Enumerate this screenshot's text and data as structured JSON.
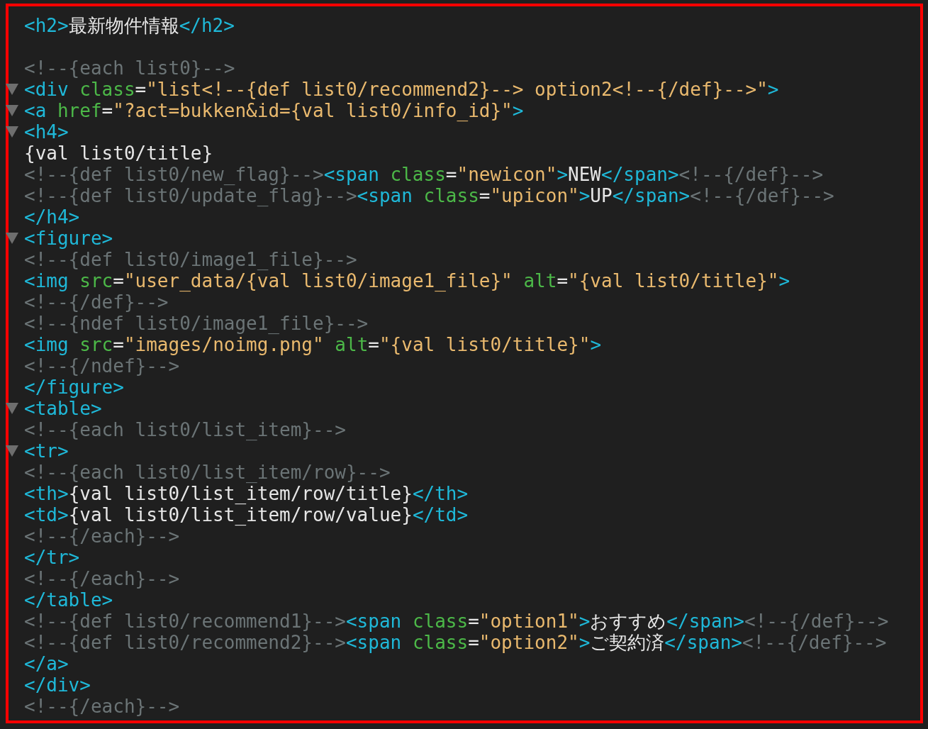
{
  "editor": {
    "lines": [
      {
        "fold": false,
        "tokens": [
          {
            "kind": "tag",
            "text": "<h2>"
          },
          {
            "kind": "text",
            "text": "最新物件情報"
          },
          {
            "kind": "tag",
            "text": "</h2>"
          }
        ]
      },
      {
        "fold": false
      },
      {
        "fold": false,
        "tokens": [
          {
            "kind": "comment",
            "text": "<!--{each list0}-->"
          }
        ]
      },
      {
        "fold": true,
        "tokens": [
          {
            "kind": "tag",
            "text": "<div "
          },
          {
            "kind": "attr",
            "text": "class"
          },
          {
            "kind": "punct",
            "text": "="
          },
          {
            "kind": "string",
            "text": "\"list<!--{def list0/recommend2}--> option2<!--{/def}-->\""
          },
          {
            "kind": "tag",
            "text": ">"
          }
        ]
      },
      {
        "fold": true,
        "tokens": [
          {
            "kind": "tag",
            "text": "<a "
          },
          {
            "kind": "attr",
            "text": "href"
          },
          {
            "kind": "punct",
            "text": "="
          },
          {
            "kind": "string",
            "text": "\"?act=bukken&id={val list0/info_id}\""
          },
          {
            "kind": "tag",
            "text": ">"
          }
        ]
      },
      {
        "fold": true,
        "tokens": [
          {
            "kind": "tag",
            "text": "<h4>"
          }
        ]
      },
      {
        "fold": false,
        "tokens": [
          {
            "kind": "text",
            "text": "{val list0/title}"
          }
        ]
      },
      {
        "fold": false,
        "tokens": [
          {
            "kind": "comment",
            "text": "<!--{def list0/new_flag}-->"
          },
          {
            "kind": "tag",
            "text": "<span "
          },
          {
            "kind": "attr",
            "text": "class"
          },
          {
            "kind": "punct",
            "text": "="
          },
          {
            "kind": "string",
            "text": "\"newicon\""
          },
          {
            "kind": "tag",
            "text": ">"
          },
          {
            "kind": "text",
            "text": "NEW"
          },
          {
            "kind": "tag",
            "text": "</span>"
          },
          {
            "kind": "comment",
            "text": "<!--{/def}-->"
          }
        ]
      },
      {
        "fold": false,
        "tokens": [
          {
            "kind": "comment",
            "text": "<!--{def list0/update_flag}-->"
          },
          {
            "kind": "tag",
            "text": "<span "
          },
          {
            "kind": "attr",
            "text": "class"
          },
          {
            "kind": "punct",
            "text": "="
          },
          {
            "kind": "string",
            "text": "\"upicon\""
          },
          {
            "kind": "tag",
            "text": ">"
          },
          {
            "kind": "text",
            "text": "UP"
          },
          {
            "kind": "tag",
            "text": "</span>"
          },
          {
            "kind": "comment",
            "text": "<!--{/def}-->"
          }
        ]
      },
      {
        "fold": false,
        "tokens": [
          {
            "kind": "tag",
            "text": "</h4>"
          }
        ]
      },
      {
        "fold": true,
        "tokens": [
          {
            "kind": "tag",
            "text": "<figure>"
          }
        ]
      },
      {
        "fold": false,
        "tokens": [
          {
            "kind": "comment",
            "text": "<!--{def list0/image1_file}-->"
          }
        ]
      },
      {
        "fold": false,
        "tokens": [
          {
            "kind": "tag",
            "text": "<img "
          },
          {
            "kind": "attr",
            "text": "src"
          },
          {
            "kind": "punct",
            "text": "="
          },
          {
            "kind": "string",
            "text": "\"user_data/{val list0/image1_file}\""
          },
          {
            "kind": "attr",
            "text": " alt"
          },
          {
            "kind": "punct",
            "text": "="
          },
          {
            "kind": "string",
            "text": "\"{val list0/title}\""
          },
          {
            "kind": "tag",
            "text": ">"
          }
        ]
      },
      {
        "fold": false,
        "tokens": [
          {
            "kind": "comment",
            "text": "<!--{/def}-->"
          }
        ]
      },
      {
        "fold": false,
        "tokens": [
          {
            "kind": "comment",
            "text": "<!--{ndef list0/image1_file}-->"
          }
        ]
      },
      {
        "fold": false,
        "tokens": [
          {
            "kind": "tag",
            "text": "<img "
          },
          {
            "kind": "attr",
            "text": "src"
          },
          {
            "kind": "punct",
            "text": "="
          },
          {
            "kind": "string",
            "text": "\"images/noimg.png\""
          },
          {
            "kind": "attr",
            "text": " alt"
          },
          {
            "kind": "punct",
            "text": "="
          },
          {
            "kind": "string",
            "text": "\"{val list0/title}\""
          },
          {
            "kind": "tag",
            "text": ">"
          }
        ]
      },
      {
        "fold": false,
        "tokens": [
          {
            "kind": "comment",
            "text": "<!--{/ndef}-->"
          }
        ]
      },
      {
        "fold": false,
        "tokens": [
          {
            "kind": "tag",
            "text": "</figure>"
          }
        ]
      },
      {
        "fold": true,
        "tokens": [
          {
            "kind": "tag",
            "text": "<table>"
          }
        ]
      },
      {
        "fold": false,
        "tokens": [
          {
            "kind": "comment",
            "text": "<!--{each list0/list_item}-->"
          }
        ]
      },
      {
        "fold": true,
        "tokens": [
          {
            "kind": "tag",
            "text": "<tr>"
          }
        ]
      },
      {
        "fold": false,
        "tokens": [
          {
            "kind": "comment",
            "text": "<!--{each list0/list_item/row}-->"
          }
        ]
      },
      {
        "fold": false,
        "tokens": [
          {
            "kind": "tag",
            "text": "<th>"
          },
          {
            "kind": "text",
            "text": "{val list0/list_item/row/title}"
          },
          {
            "kind": "tag",
            "text": "</th>"
          }
        ]
      },
      {
        "fold": false,
        "tokens": [
          {
            "kind": "tag",
            "text": "<td>"
          },
          {
            "kind": "text",
            "text": "{val list0/list_item/row/value}"
          },
          {
            "kind": "tag",
            "text": "</td>"
          }
        ]
      },
      {
        "fold": false,
        "tokens": [
          {
            "kind": "comment",
            "text": "<!--{/each}-->"
          }
        ]
      },
      {
        "fold": false,
        "tokens": [
          {
            "kind": "tag",
            "text": "</tr>"
          }
        ]
      },
      {
        "fold": false,
        "tokens": [
          {
            "kind": "comment",
            "text": "<!--{/each}-->"
          }
        ]
      },
      {
        "fold": false,
        "tokens": [
          {
            "kind": "tag",
            "text": "</table>"
          }
        ]
      },
      {
        "fold": false,
        "tokens": [
          {
            "kind": "comment",
            "text": "<!--{def list0/recommend1}-->"
          },
          {
            "kind": "tag",
            "text": "<span "
          },
          {
            "kind": "attr",
            "text": "class"
          },
          {
            "kind": "punct",
            "text": "="
          },
          {
            "kind": "string",
            "text": "\"option1\""
          },
          {
            "kind": "tag",
            "text": ">"
          },
          {
            "kind": "text",
            "text": "おすすめ"
          },
          {
            "kind": "tag",
            "text": "</span>"
          },
          {
            "kind": "comment",
            "text": "<!--{/def}-->"
          }
        ]
      },
      {
        "fold": false,
        "tokens": [
          {
            "kind": "comment",
            "text": "<!--{def list0/recommend2}-->"
          },
          {
            "kind": "tag",
            "text": "<span "
          },
          {
            "kind": "attr",
            "text": "class"
          },
          {
            "kind": "punct",
            "text": "="
          },
          {
            "kind": "string",
            "text": "\"option2\""
          },
          {
            "kind": "tag",
            "text": ">"
          },
          {
            "kind": "text",
            "text": "ご契約済"
          },
          {
            "kind": "tag",
            "text": "</span>"
          },
          {
            "kind": "comment",
            "text": "<!--{/def}-->"
          }
        ]
      },
      {
        "fold": false,
        "tokens": [
          {
            "kind": "tag",
            "text": "</a>"
          }
        ]
      },
      {
        "fold": false,
        "tokens": [
          {
            "kind": "tag",
            "text": "</div>"
          }
        ]
      },
      {
        "fold": false,
        "tokens": [
          {
            "kind": "comment",
            "text": "<!--{/each}-->"
          }
        ]
      }
    ]
  }
}
